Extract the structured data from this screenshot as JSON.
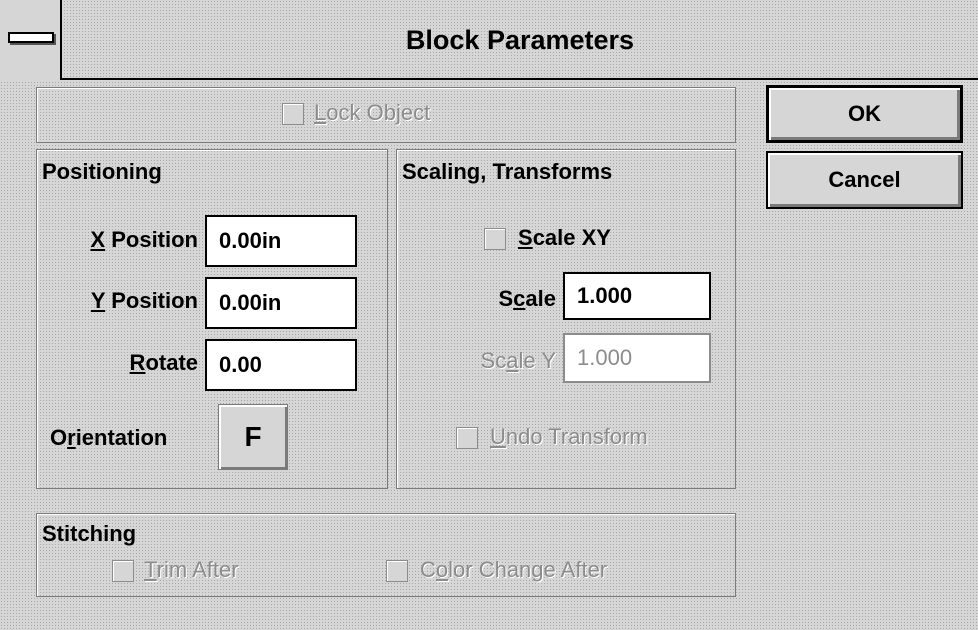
{
  "window": {
    "title": "Block Parameters"
  },
  "lock_object": {
    "pre": "",
    "acc": "L",
    "post": "ock Object"
  },
  "buttons": {
    "ok": "OK",
    "cancel": "Cancel"
  },
  "positioning": {
    "heading": "Positioning",
    "x_label": {
      "pre": "",
      "acc": "X",
      "post": " Position"
    },
    "x_value": "0.00in",
    "y_label": {
      "pre": "",
      "acc": "Y",
      "post": " Position"
    },
    "y_value": "0.00in",
    "rotate_label": {
      "pre": "",
      "acc": "R",
      "post": "otate"
    },
    "rotate_value": "0.00",
    "orientation_label": {
      "pre": "O",
      "acc": "r",
      "post": "ientation"
    },
    "orientation_value": "F"
  },
  "scaling": {
    "heading": "Scaling, Transforms",
    "scale_xy": {
      "pre": "",
      "acc": "S",
      "post": "cale XY"
    },
    "scale_label": {
      "pre": "S",
      "acc": "c",
      "post": "ale"
    },
    "scale_value": "1.000",
    "scale_y_label": {
      "pre": "Sc",
      "acc": "a",
      "post": "le Y"
    },
    "scale_y_value": "1.000",
    "undo": {
      "pre": "",
      "acc": "U",
      "post": "ndo Transform"
    }
  },
  "stitching": {
    "heading": "Stitching",
    "trim": {
      "pre": "",
      "acc": "T",
      "post": "rim After"
    },
    "color_change": {
      "pre": "C",
      "acc": "o",
      "post": "lor Change After"
    }
  }
}
